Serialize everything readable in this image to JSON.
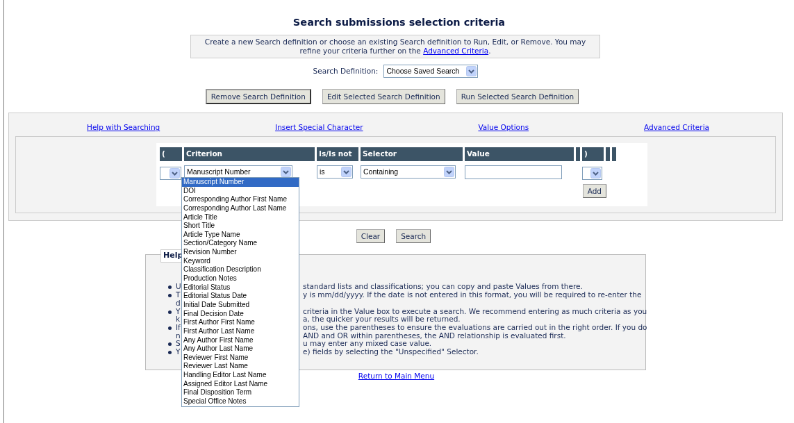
{
  "title": "Search submissions selection criteria",
  "intro": {
    "text": "Create a new Search definition or choose an existing Search definition to Run, Edit, or Remove.  You may refine your criteria further on the",
    "link": "Advanced Criteria",
    "after": "."
  },
  "search_definition": {
    "label": "Search Definition:",
    "value": "Choose Saved Search"
  },
  "definition_buttons": [
    "Remove Search Definition",
    "Edit Selected Search Definition",
    "Run Selected Search Definition"
  ],
  "links": [
    "Help with Searching",
    "Insert Special Character",
    "Value Options",
    "Advanced Criteria"
  ],
  "table": {
    "columns": [
      "(",
      "Criterion",
      "Is/Is not",
      "Selector",
      "Value",
      ")"
    ],
    "row": {
      "criterion": "Manuscript Number",
      "is_not": "is",
      "selector": "Containing"
    },
    "add_button": "Add"
  },
  "criterion_options": [
    {
      "label": "Manuscript Number",
      "selected": true
    },
    {
      "label": "DOI",
      "selected": false
    },
    {
      "label": "Corresponding Author First Name",
      "selected": false
    },
    {
      "label": "Corresponding Author Last Name",
      "selected": false
    },
    {
      "label": "Article Title",
      "selected": false
    },
    {
      "label": "Short Title",
      "selected": false
    },
    {
      "label": "Article Type Name",
      "selected": false
    },
    {
      "label": "Section/Category Name",
      "selected": false
    },
    {
      "label": "Revision Number",
      "selected": false
    },
    {
      "label": "Keyword",
      "selected": false
    },
    {
      "label": "Classification Description",
      "selected": false
    },
    {
      "label": "Production Notes",
      "selected": false
    },
    {
      "label": "Editorial Status",
      "selected": false
    },
    {
      "label": "Editorial Status Date",
      "selected": false
    },
    {
      "label": "Initial Date Submitted",
      "selected": false
    },
    {
      "label": "Final Decision Date",
      "selected": false
    },
    {
      "label": "First Author First Name",
      "selected": false
    },
    {
      "label": "First Author Last Name",
      "selected": false
    },
    {
      "label": "Any Author First Name",
      "selected": false
    },
    {
      "label": "Any Author Last Name",
      "selected": false
    },
    {
      "label": "Reviewer First Name",
      "selected": false
    },
    {
      "label": "Reviewer Last Name",
      "selected": false
    },
    {
      "label": "Handling Editor Last Name",
      "selected": false
    },
    {
      "label": "Assigned Editor Last Name",
      "selected": false
    },
    {
      "label": "Final Disposition Term",
      "selected": false
    },
    {
      "label": "Special Office Notes",
      "selected": false
    }
  ],
  "action_buttons": [
    "Clear",
    "Search"
  ],
  "help": {
    "legend": "Help",
    "items": [
      {
        "lines": [
          {
            "start": "U",
            "end": "standard lists and classifications; you can copy and paste Values from there."
          }
        ]
      },
      {
        "lines": [
          {
            "start": "T",
            "end": "y is mm/dd/yyyy.  If the date is not entered in this format, you will be required to re-enter the"
          },
          {
            "start": "d"
          }
        ]
      },
      {
        "lines": [
          {
            "start": "Y",
            "end": "criteria in the Value box to execute a search. We recommend entering as much criteria as you"
          },
          {
            "start": "k",
            "end": "a, the quicker your results will be returned."
          }
        ]
      },
      {
        "lines": [
          {
            "start": "If",
            "end": "ons, use the parentheses to ensure the evaluations are carried out in the right order. If you do"
          },
          {
            "start": "n",
            "end": "AND and OR within parentheses, the AND relationship is evaluated first."
          }
        ]
      },
      {
        "lines": [
          {
            "start": "S",
            "end": "u may enter any mixed case value."
          }
        ]
      },
      {
        "lines": [
          {
            "start": "Y",
            "end": "e) fields by selecting the \"Unspecified\" Selector."
          }
        ]
      }
    ]
  },
  "return_link": "Return to Main Menu"
}
